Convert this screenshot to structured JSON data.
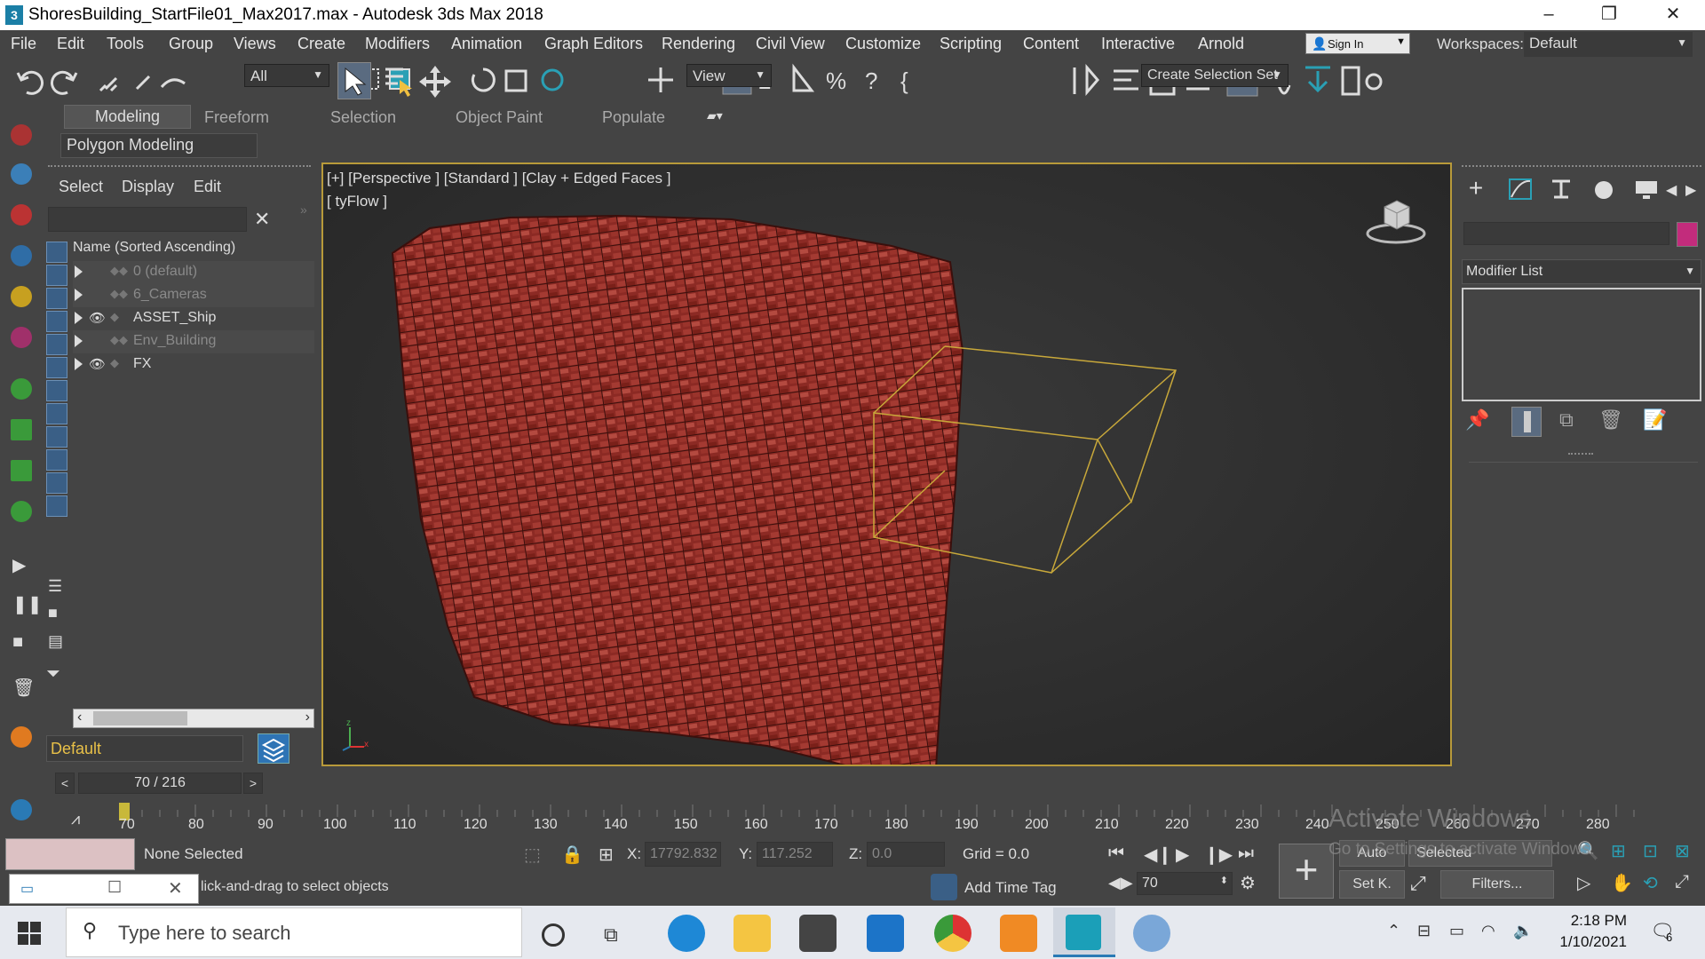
{
  "window": {
    "title": "ShoresBuilding_StartFile01_Max2017.max - Autodesk 3ds Max 2018",
    "app_icon_glyph": "3",
    "controls": [
      "–",
      "❐",
      "✕"
    ]
  },
  "menu": {
    "items": [
      "File",
      "Edit",
      "Tools",
      "Group",
      "Views",
      "Create",
      "Modifiers",
      "Animation",
      "Graph Editors",
      "Rendering",
      "Civil View",
      "Customize",
      "Scripting",
      "Content",
      "Interactive",
      "Arnold"
    ],
    "sign_in": "Sign In",
    "workspaces_label": "Workspaces:",
    "workspaces_value": "Default"
  },
  "toolbar": {
    "filter_value": "All",
    "ref_coord_value": "View",
    "selection_set_placeholder": "Create Selection Set"
  },
  "ribbon": {
    "tabs": [
      "Modeling",
      "Freeform",
      "Selection",
      "Object Paint",
      "Populate"
    ],
    "active_panel": "Polygon Modeling"
  },
  "explorer": {
    "tabs": [
      "Select",
      "Display",
      "Edit"
    ],
    "header": "Name (Sorted Ascending)",
    "rows": [
      {
        "name": "0 (default)",
        "visible": false
      },
      {
        "name": "6_Cameras",
        "visible": false
      },
      {
        "name": "ASSET_Ship",
        "visible": true
      },
      {
        "name": "Env_Building",
        "visible": false
      },
      {
        "name": "FX",
        "visible": true
      }
    ],
    "layer_value": "Default",
    "clear_glyph": "✕"
  },
  "viewport": {
    "label_line1": "[+] [Perspective ]  [Standard ] [Clay + Edged Faces ]",
    "label_line2": "[ tyFlow ]",
    "object_color": "#8c2a24",
    "bbox_color": "#c8a83a"
  },
  "command_panel": {
    "modifier_list": "Modifier List",
    "object_color": "#c22c7c"
  },
  "timeline": {
    "frame_counter": "70 / 216",
    "ticks": [
      "70",
      "80",
      "90",
      "100",
      "110",
      "120",
      "130",
      "140",
      "150",
      "160",
      "170",
      "180",
      "190",
      "200",
      "210",
      "220",
      "230",
      "240",
      "250",
      "260",
      "270",
      "280"
    ]
  },
  "status": {
    "selection": "None Selected",
    "prompt": "lick-and-drag to select objects",
    "x_label": "X:",
    "x_value": "17792.832",
    "y_label": "Y:",
    "y_value": "117.252",
    "z_label": "Z:",
    "z_value": "0.0",
    "grid": "Grid = 0.0",
    "add_time_tag": "Add Time Tag",
    "current_frame": "70",
    "auto_key": "Auto",
    "selected": "Selected",
    "set_key": "Set K.",
    "filters": "Filters...",
    "watermark_line1": "Activate Windows",
    "watermark_line2": "Go to Settings to activate Windows."
  },
  "taskbar": {
    "search_placeholder": "Type here to search",
    "time": "2:18 PM",
    "date": "1/10/2021",
    "notification_count": "6"
  }
}
